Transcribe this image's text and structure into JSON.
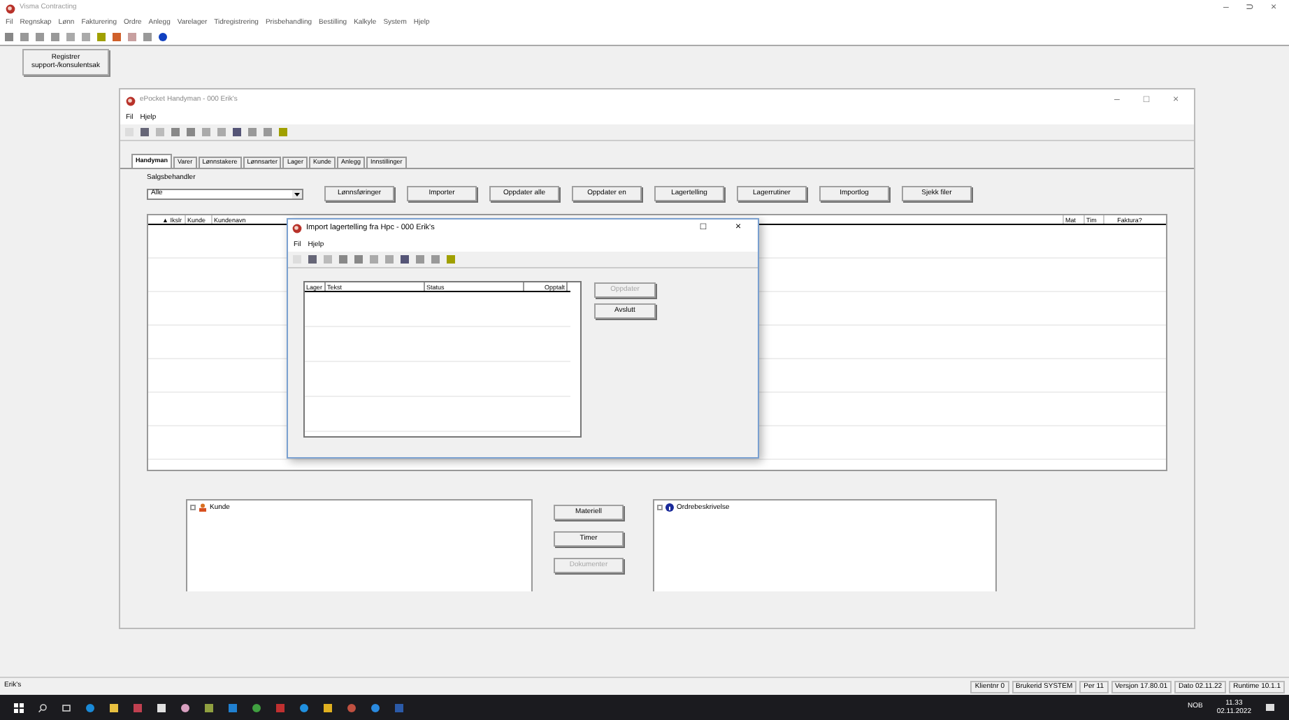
{
  "app": {
    "title": "Visma Contracting",
    "window_controls": [
      "–",
      "⊃",
      "×"
    ],
    "menu": [
      "Fil",
      "Regnskap",
      "Lønn",
      "Fakturering",
      "Ordre",
      "Anlegg",
      "Varelager",
      "Tidregistrering",
      "Prisbehandling",
      "Bestilling",
      "Kalkyle",
      "System",
      "Hjelp"
    ],
    "side_button": "Registrer support-/konsulentsak"
  },
  "main_window": {
    "title": "ePocket Handyman - 000 Erik's",
    "window_controls": [
      "–",
      "□",
      "×"
    ],
    "menu": [
      "Fil",
      "Hjelp"
    ],
    "tabs": [
      {
        "label": "Handyman",
        "selected": true
      },
      {
        "label": "Varer",
        "selected": false
      },
      {
        "label": "Lønnstakere",
        "selected": false
      },
      {
        "label": "Lønnsarter",
        "selected": false
      },
      {
        "label": "Lager",
        "selected": false
      },
      {
        "label": "Kunde",
        "selected": false
      },
      {
        "label": "Anlegg",
        "selected": false
      },
      {
        "label": "Innstillinger",
        "selected": false
      }
    ],
    "filter_label": "Salgsbehandler",
    "filter_value": "Alle",
    "buttons": [
      "Lønnsføringer",
      "Importer",
      "Oppdater alle",
      "Oppdater en",
      "Lagertelling",
      "Lagerrutiner",
      "Importlog",
      "Sjekk filer"
    ],
    "table": {
      "columns_left": [
        "▲ Ikslr",
        "Kunde",
        "Kundenavn"
      ],
      "columns_right": [
        "Mat",
        "Tim",
        "Faktura?"
      ]
    },
    "left_tree": {
      "label": "Kunde"
    },
    "right_tree": {
      "label": "Ordrebeskrivelse"
    },
    "middle_buttons": [
      {
        "label": "Materiell",
        "disabled": false
      },
      {
        "label": "Timer",
        "disabled": false
      },
      {
        "label": "Dokumenter",
        "disabled": true
      }
    ]
  },
  "dialog": {
    "title": "Import lagertelling fra Hpc - 000 Erik's",
    "window_controls": [
      "□",
      "×"
    ],
    "menu": [
      "Fil",
      "Hjelp"
    ],
    "columns": [
      "Lager",
      "Tekst",
      "Status",
      "Opptalt"
    ],
    "buttons": [
      {
        "label": "Oppdater",
        "disabled": true
      },
      {
        "label": "Avslutt",
        "disabled": false
      }
    ]
  },
  "status_bar": {
    "left": "Erik's",
    "cells": [
      "Klientnr 0",
      "Brukerid SYSTEM",
      "Per 11",
      "Versjon 17.80.01",
      "Dato 02.11.22",
      "Runtime 10.1.1"
    ]
  },
  "taskbar": {
    "language": "NOB",
    "time": "11.33",
    "date": "02.11.2022"
  }
}
